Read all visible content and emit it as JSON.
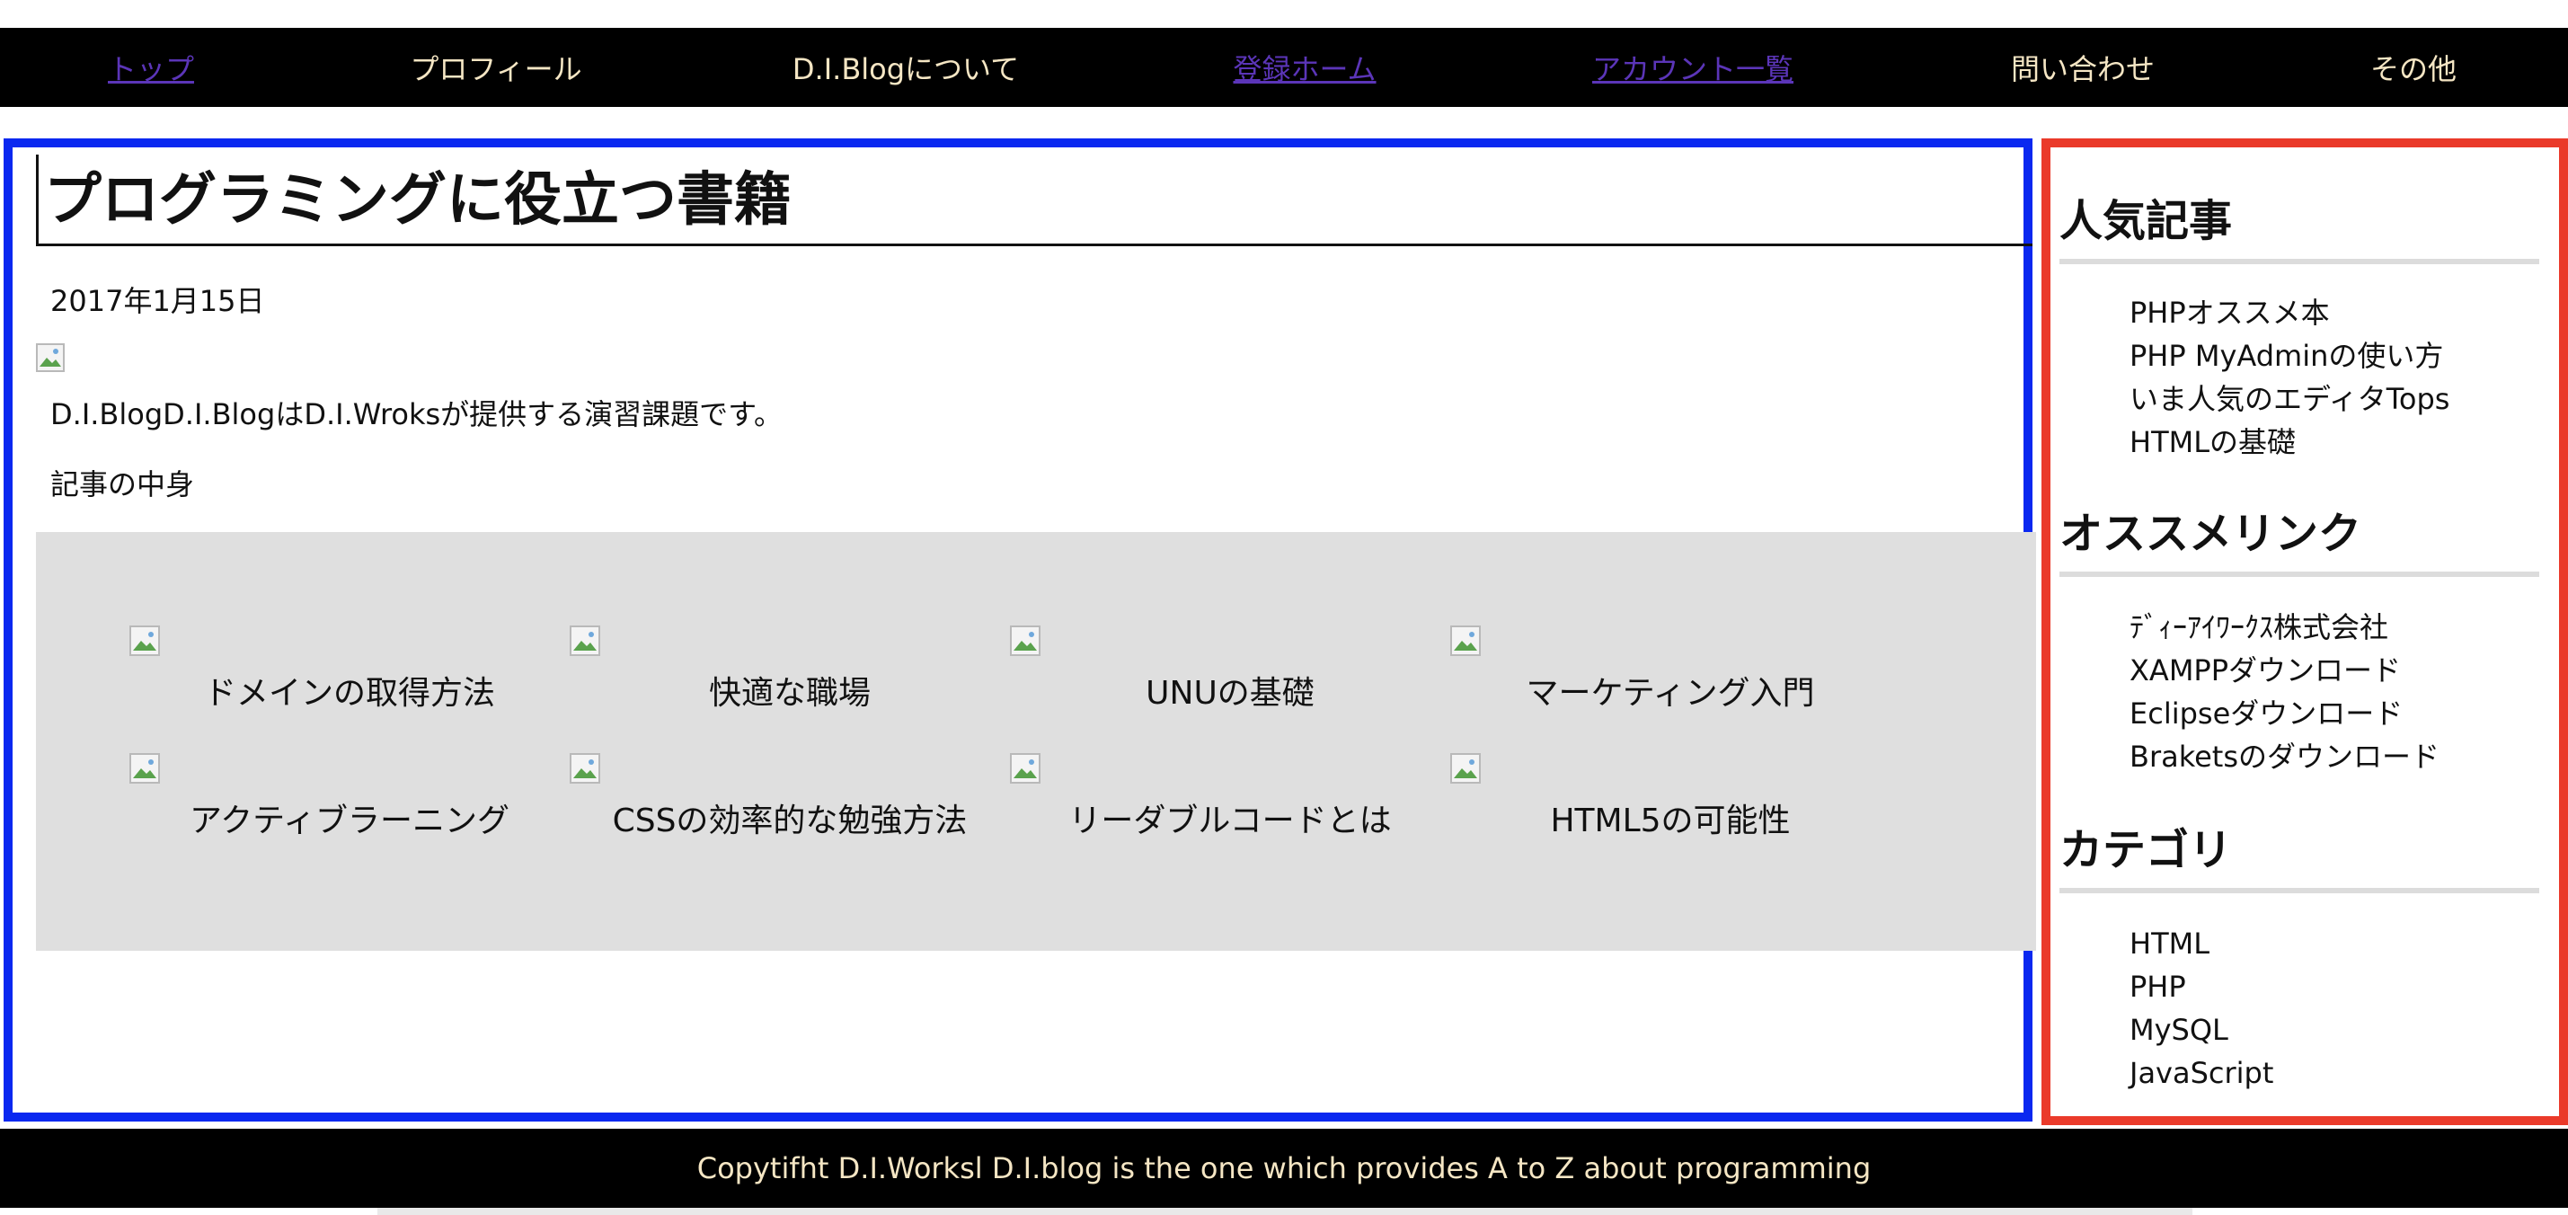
{
  "nav": {
    "items": [
      {
        "label": "トップ",
        "link": true
      },
      {
        "label": "プロフィール",
        "link": false
      },
      {
        "label": "D.I.Blogについて",
        "link": false
      },
      {
        "label": "登録ホーム",
        "link": true
      },
      {
        "label": "アカウント一覧",
        "link": true
      },
      {
        "label": "問い合わせ",
        "link": false
      },
      {
        "label": "その他",
        "link": false
      }
    ]
  },
  "article": {
    "title": "プログラミングに役立つ書籍",
    "date": "2017年1月15日",
    "image_icon": "broken-image-icon",
    "lead": "D.I.BlogD.I.BlogはD.I.Wroksが提供する演習課題です。",
    "body": "記事の中身"
  },
  "related": {
    "cards": [
      {
        "label": "ドメインの取得方法"
      },
      {
        "label": "快適な職場"
      },
      {
        "label": "UNUの基礎"
      },
      {
        "label": "マーケティング入門"
      },
      {
        "label": "アクティブラーニング"
      },
      {
        "label": "CSSの効率的な勉強方法"
      },
      {
        "label": "リーダブルコードとは"
      },
      {
        "label": "HTML5の可能性"
      }
    ]
  },
  "sidebar": {
    "popular": {
      "heading": "人気記事",
      "items": [
        "PHPオススメ本",
        "PHP MyAdminの使い方",
        "いま人気のエディタTops",
        "HTMLの基礎"
      ]
    },
    "links": {
      "heading": "オススメリンク",
      "items": [
        "ﾃﾞｨｰｱｲﾜｰｸｽ株式会社",
        "XAMPPダウンロード",
        "Eclipseダウンロード",
        "Braketsのダウンロード"
      ]
    },
    "categories": {
      "heading": "カテゴリ",
      "items": [
        "HTML",
        "PHP",
        "MySQL",
        "JavaScript"
      ]
    }
  },
  "footer": {
    "text": "Copytifht D.I.Worksl D.I.blog is the one which provides A to Z about programming"
  },
  "colors": {
    "nav_bg": "#000000",
    "nav_text": "#f5e6c4",
    "link": "#5b35b8",
    "main_border": "#0a28f0",
    "sidebar_border": "#ea3a2a",
    "related_bg": "#dfdfdf"
  }
}
